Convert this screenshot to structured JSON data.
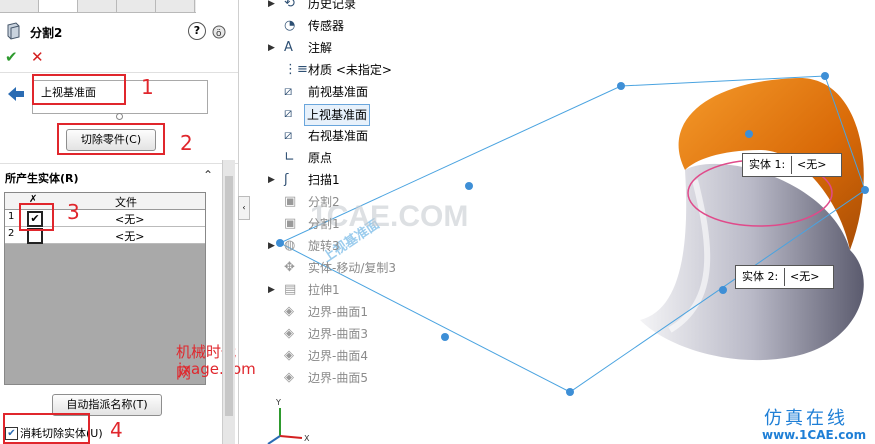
{
  "panel": {
    "title": "分割2",
    "plane_value": "上视基准面",
    "cut_part_button": "切除零件(C)",
    "section_title": "所产生实体(R)",
    "table_header_file": "文件",
    "rows": [
      {
        "num": "1",
        "file": "<无>",
        "checked": true
      },
      {
        "num": "2",
        "file": "<无>",
        "checked": false
      }
    ],
    "auto_assign_button": "自动指派名称(T)",
    "consume_label": "消耗切除实体(U)"
  },
  "annotations": {
    "n1": "1",
    "n2": "2",
    "n3": "3",
    "n4": "4",
    "watermark_cn": "机械时代网",
    "watermark_url": "jxage.com",
    "watermark_center": "1CAE.COM",
    "brand_cn": "仿真在线",
    "brand_url": "www.1CAE.com",
    "plane_tag": "上视基准面"
  },
  "tree": [
    {
      "label": "历史记录",
      "icon": "history-icon",
      "arrow": true,
      "dim": false
    },
    {
      "label": "传感器",
      "icon": "sensor-icon",
      "arrow": false,
      "dim": false
    },
    {
      "label": "注解",
      "icon": "annotation-icon",
      "arrow": true,
      "dim": false
    },
    {
      "label": "材质 <未指定>",
      "icon": "material-icon",
      "arrow": false,
      "dim": false
    },
    {
      "label": "前视基准面",
      "icon": "plane-icon",
      "arrow": false,
      "dim": false
    },
    {
      "label": "上视基准面",
      "icon": "plane-icon",
      "arrow": false,
      "dim": false,
      "selected": true
    },
    {
      "label": "右视基准面",
      "icon": "plane-icon",
      "arrow": false,
      "dim": false
    },
    {
      "label": "原点",
      "icon": "origin-icon",
      "arrow": false,
      "dim": false
    },
    {
      "label": "扫描1",
      "icon": "sweep-icon",
      "arrow": true,
      "dim": false
    },
    {
      "label": "分割2",
      "icon": "split-icon",
      "arrow": false,
      "dim": true
    },
    {
      "label": "分割1",
      "icon": "split-icon",
      "arrow": false,
      "dim": true
    },
    {
      "label": "旋转3",
      "icon": "revolve-icon",
      "arrow": true,
      "dim": true
    },
    {
      "label": "实体-移动/复制3",
      "icon": "move-copy-icon",
      "arrow": false,
      "dim": true
    },
    {
      "label": "拉伸1",
      "icon": "extrude-icon",
      "arrow": true,
      "dim": true
    },
    {
      "label": "边界-曲面1",
      "icon": "boundary-surface-icon",
      "arrow": false,
      "dim": true
    },
    {
      "label": "边界-曲面3",
      "icon": "boundary-surface-icon",
      "arrow": false,
      "dim": true
    },
    {
      "label": "边界-曲面4",
      "icon": "boundary-surface-icon",
      "arrow": false,
      "dim": true
    },
    {
      "label": "边界-曲面5",
      "icon": "boundary-surface-icon",
      "arrow": false,
      "dim": true
    }
  ],
  "callouts": [
    {
      "label": "实体 1:",
      "value": "<无>"
    },
    {
      "label": "实体 2:",
      "value": "<无>"
    }
  ],
  "colors": {
    "accent_red": "#e0262c",
    "orange_surface": "#e2780f",
    "plane_blue": "#4aa3e0"
  }
}
